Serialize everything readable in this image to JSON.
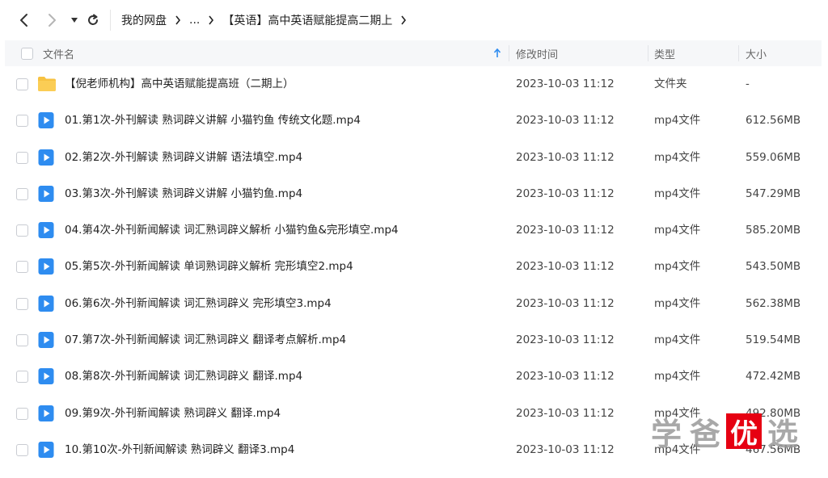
{
  "toolbar": {
    "back_icon": "chevron-left-icon",
    "forward_icon": "chevron-right-icon",
    "dropdown_icon": "caret-down-icon",
    "refresh_icon": "refresh-icon"
  },
  "breadcrumb": {
    "root": "我的网盘",
    "ellipsis": "...",
    "current": "【英语】高中英语赋能提高二期上"
  },
  "columns": {
    "name": "文件名",
    "modified": "修改时间",
    "type": "类型",
    "size": "大小",
    "sort_icon": "sort-ascending-icon"
  },
  "files": [
    {
      "name": "【倪老师机构】高中英语赋能提高班（二期上）",
      "modified": "2023-10-03 11:12",
      "type": "文件夹",
      "size": "-",
      "icon": "folder-icon"
    },
    {
      "name": "01.第1次-外刊解读 熟词辟义讲解 小猫钓鱼 传统文化题.mp4",
      "modified": "2023-10-03 11:12",
      "type": "mp4文件",
      "size": "612.56MB",
      "icon": "video-file-icon"
    },
    {
      "name": "02.第2次-外刊解读 熟词辟义讲解 语法填空.mp4",
      "modified": "2023-10-03 11:12",
      "type": "mp4文件",
      "size": "559.06MB",
      "icon": "video-file-icon"
    },
    {
      "name": "03.第3次-外刊解读 熟词辟义讲解 小猫钓鱼.mp4",
      "modified": "2023-10-03 11:12",
      "type": "mp4文件",
      "size": "547.29MB",
      "icon": "video-file-icon"
    },
    {
      "name": "04.第4次-外刊新闻解读 词汇熟词辟义解析 小猫钓鱼&完形填空.mp4",
      "modified": "2023-10-03 11:12",
      "type": "mp4文件",
      "size": "585.20MB",
      "icon": "video-file-icon"
    },
    {
      "name": "05.第5次-外刊新闻解读 单词熟词辟义解析 完形填空2.mp4",
      "modified": "2023-10-03 11:12",
      "type": "mp4文件",
      "size": "543.50MB",
      "icon": "video-file-icon"
    },
    {
      "name": "06.第6次-外刊新闻解读 词汇熟词辟义 完形填空3.mp4",
      "modified": "2023-10-03 11:12",
      "type": "mp4文件",
      "size": "562.38MB",
      "icon": "video-file-icon"
    },
    {
      "name": "07.第7次-外刊新闻解读 词汇熟词辟义 翻译考点解析.mp4",
      "modified": "2023-10-03 11:12",
      "type": "mp4文件",
      "size": "519.54MB",
      "icon": "video-file-icon"
    },
    {
      "name": "08.第8次-外刊新闻解读 词汇熟词辟义 翻译.mp4",
      "modified": "2023-10-03 11:12",
      "type": "mp4文件",
      "size": "472.42MB",
      "icon": "video-file-icon"
    },
    {
      "name": "09.第9次-外刊新闻解读 熟词辟义 翻译.mp4",
      "modified": "2023-10-03 11:12",
      "type": "mp4文件",
      "size": "492.80MB",
      "icon": "video-file-icon"
    },
    {
      "name": "10.第10次-外刊新闻解读 熟词辟义 翻译3.mp4",
      "modified": "2023-10-03 11:12",
      "type": "mp4文件",
      "size": "467.56MB",
      "icon": "video-file-icon"
    }
  ],
  "watermark": {
    "chars": [
      "学",
      "爸",
      "优",
      "选"
    ],
    "accent_color": "#e60012"
  },
  "colors": {
    "folder": "#f7c242",
    "video_icon": "#2e8cf0",
    "header_bg": "#f6f7f9"
  }
}
